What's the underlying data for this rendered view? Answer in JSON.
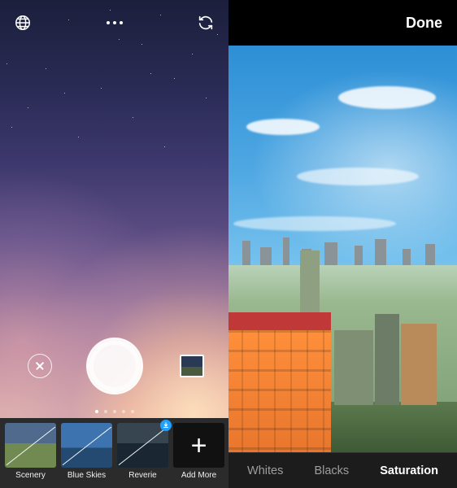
{
  "left": {
    "filters": [
      {
        "label": "Scenery"
      },
      {
        "label": "Blue Skies"
      },
      {
        "label": "Reverie"
      },
      {
        "label": "Add More"
      }
    ]
  },
  "right": {
    "done_label": "Done",
    "adjustments": {
      "whites": "Whites",
      "blacks": "Blacks",
      "saturation": "Saturation"
    }
  }
}
